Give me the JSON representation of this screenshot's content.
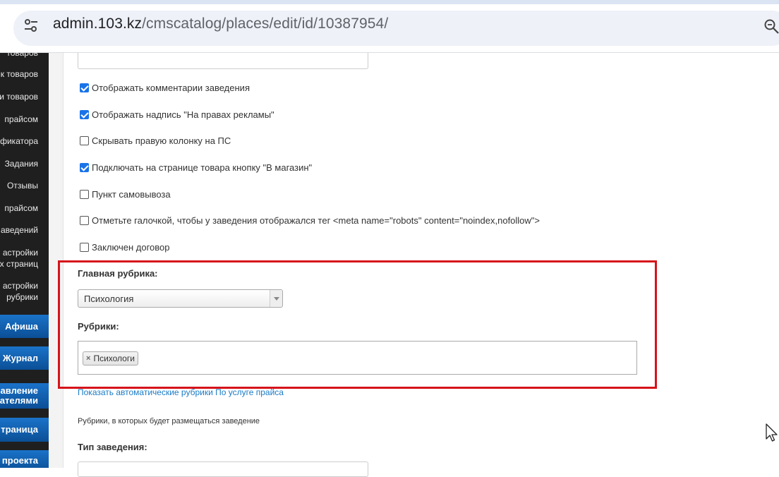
{
  "browser": {
    "url_host": "admin.103.kz",
    "url_path": "/cmscatalog/places/edit/id/10387954/"
  },
  "sidebar": {
    "items": [
      "товаров",
      "к товаров",
      "и товаров",
      "прайсом",
      "фикатора",
      "Задания",
      "Отзывы",
      "прайсом",
      "аведений",
      "астройки",
      "х страниц",
      "астройки",
      "рубрики"
    ],
    "buttons": [
      "Афиша",
      "Журнал",
      "авление",
      "ателями",
      "траница",
      "проекта"
    ]
  },
  "form": {
    "checkboxes": [
      {
        "label": "Отображать комментарии заведения",
        "checked": true
      },
      {
        "label": "Отображать надпись \"На правах рекламы\"",
        "checked": true
      },
      {
        "label": "Скрывать правую колонку на ПС",
        "checked": false
      },
      {
        "label": "Подключать на странице товара кнопку \"В магазин\"",
        "checked": true
      },
      {
        "label": "Пункт самовывоза",
        "checked": false
      },
      {
        "label": "Отметьте галочкой, чтобы у заведения отображался тег <meta name=\"robots\" content=\"noindex,nofollow\">",
        "checked": false
      },
      {
        "label": "Заключен договор",
        "checked": false
      }
    ],
    "main_rubric_label": "Главная рубрика:",
    "main_rubric_value": "Психология",
    "rubrics_label": "Рубрики:",
    "rubrics_tags": [
      "Психологи"
    ],
    "tag_remove": "×",
    "links": {
      "auto": "Показать автоматические рубрики",
      "price": "По услуге прайса"
    },
    "hint": "Рубрики, в которых будет размещаться заведение",
    "place_type_label": "Тип заведения:"
  },
  "colors": {
    "highlight": "#d6131a",
    "link": "#1a7bc5",
    "sidebar_button": "#1a73c9",
    "checkbox": "#1a73e8"
  }
}
